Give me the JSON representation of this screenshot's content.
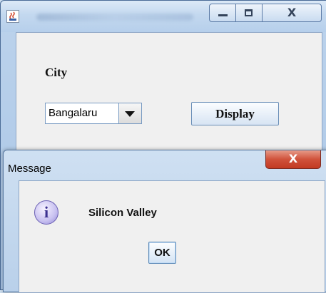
{
  "main_window": {
    "title": "",
    "city_label": "City",
    "city_combo": {
      "selected": "Bangalaru"
    },
    "display_button": "Display",
    "icons": {
      "app": "java-icon",
      "minimize": "minimize-icon",
      "maximize": "maximize-icon",
      "close": "close-icon"
    },
    "close_glyph": "X"
  },
  "dialog": {
    "title": "Message",
    "close_glyph": "X",
    "icon": "info-icon",
    "icon_glyph": "i",
    "message": "Silicon Valley",
    "ok_button": "OK"
  }
}
